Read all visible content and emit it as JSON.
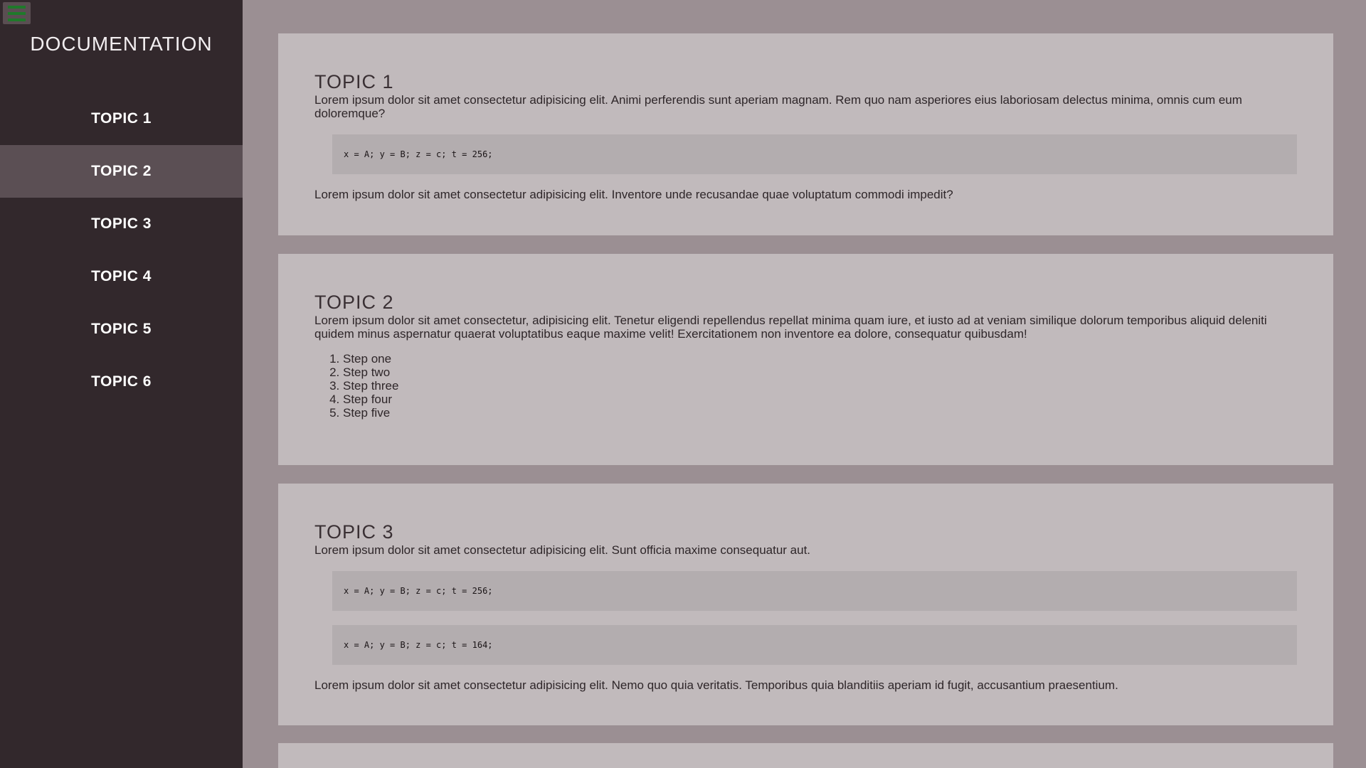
{
  "sidebar": {
    "title": "DOCUMENTATION",
    "items": [
      {
        "label": "TOPIC 1"
      },
      {
        "label": "TOPIC 2"
      },
      {
        "label": "TOPIC 3"
      },
      {
        "label": "TOPIC 4"
      },
      {
        "label": "TOPIC 5"
      },
      {
        "label": "TOPIC 6"
      }
    ],
    "active_index": 1
  },
  "colors": {
    "sidebar_bg": "#32282c",
    "sidebar_active": "#5b4f54",
    "page_bg": "#9b8f93",
    "card_bg": "#c1babc",
    "code_bg": "#b3adaf",
    "menu_icon": "#1f7a2a"
  },
  "icons": {
    "menu": "hamburger-menu-icon"
  },
  "topics": [
    {
      "title": "TOPIC 1",
      "intro": "Lorem ipsum dolor sit amet consectetur adipisicing elit. Animi perferendis sunt aperiam magnam. Rem quo nam asperiores eius laboriosam delectus minima, omnis cum eum doloremque?",
      "code": [
        "x = A; y = B; z = c; t = 256;"
      ],
      "outro": "Lorem ipsum dolor sit amet consectetur adipisicing elit. Inventore unde recusandae quae voluptatum commodi impedit?"
    },
    {
      "title": "TOPIC 2",
      "intro": "Lorem ipsum dolor sit amet consectetur, adipisicing elit. Tenetur eligendi repellendus repellat minima quam iure, et iusto ad at veniam similique dolorum temporibus aliquid deleniti quidem minus aspernatur quaerat voluptatibus eaque maxime velit! Exercitationem non inventore ea dolore, consequatur quibusdam!",
      "steps": [
        "Step one",
        "Step two",
        "Step three",
        "Step four",
        "Step five"
      ]
    },
    {
      "title": "TOPIC 3",
      "intro": "Lorem ipsum dolor sit amet consectetur adipisicing elit. Sunt officia maxime consequatur aut.",
      "code": [
        "x = A; y = B; z = c; t = 256;",
        "x = A; y = B; z = c; t = 164;"
      ],
      "outro": "Lorem ipsum dolor sit amet consectetur adipisicing elit. Nemo quo quia veritatis. Temporibus quia blanditiis aperiam id fugit, accusantium praesentium."
    }
  ]
}
